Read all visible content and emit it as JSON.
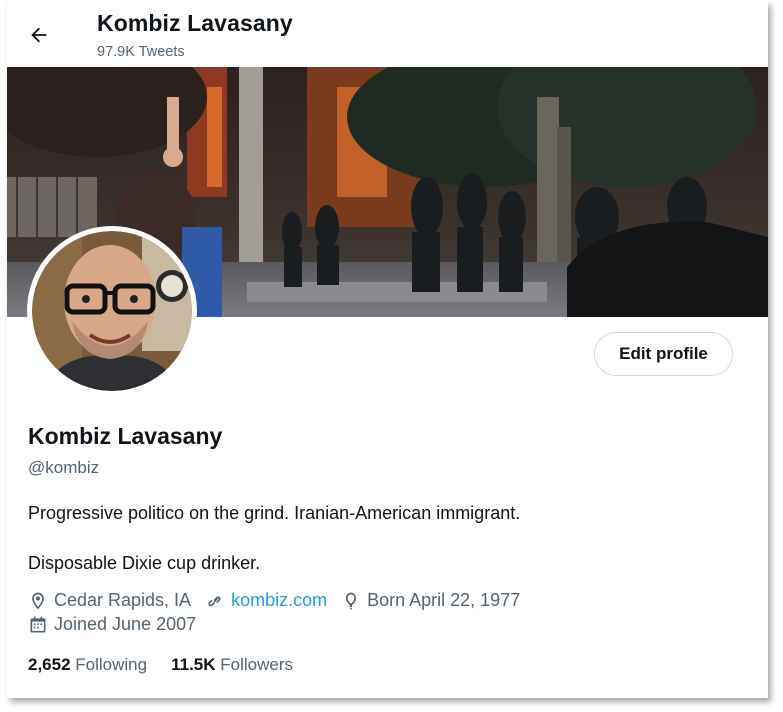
{
  "header": {
    "back_icon": "arrow-left-icon",
    "title": "Kombiz Lavasany",
    "subtitle": "97.9K Tweets"
  },
  "profile": {
    "edit_label": "Edit profile",
    "name": "Kombiz Lavasany",
    "handle": "@kombiz",
    "bio_line1": "Progressive politico on the grind. Iranian-American immigrant.",
    "bio_line2": "Disposable Dixie cup drinker.",
    "location": "Cedar Rapids, IA",
    "website": "kombiz.com",
    "birthday": "Born April 22, 1977",
    "joined": "Joined June 2007",
    "following_count": "2,652",
    "following_label": "Following",
    "followers_count": "11.5K",
    "followers_label": "Followers"
  },
  "icons": {
    "location": "location-pin-icon",
    "website": "link-icon",
    "birthday": "balloon-icon",
    "joined": "calendar-icon"
  },
  "colors": {
    "accent": "#1d9bf0",
    "text_primary": "#0f1419",
    "text_secondary": "#536471",
    "border": "#cfd9de"
  }
}
